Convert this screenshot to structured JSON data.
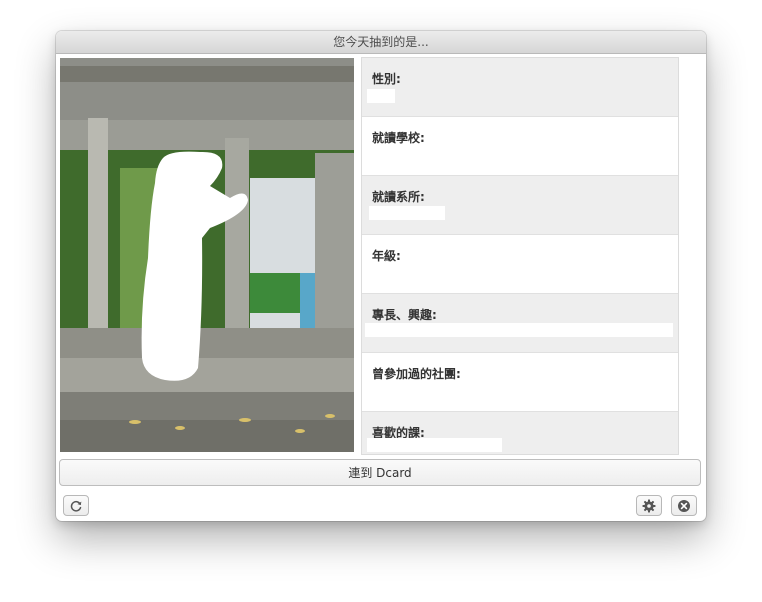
{
  "window": {
    "title": "您今天抽到的是..."
  },
  "profile": {
    "fields": [
      {
        "label": "性別:",
        "shaded": true
      },
      {
        "label": "就讀學校:",
        "shaded": false
      },
      {
        "label": "就讀系所:",
        "shaded": true
      },
      {
        "label": "年級:",
        "shaded": false
      },
      {
        "label": "專長、興趣:",
        "shaded": true
      },
      {
        "label": "曾參加過的社團:",
        "shaded": false
      },
      {
        "label": "喜歡的課:",
        "shaded": true
      }
    ]
  },
  "actions": {
    "dcard_label": "連到 Dcard",
    "refresh_icon": "refresh-icon",
    "settings_icon": "gear-icon",
    "close_icon": "close-circle-icon"
  },
  "colors": {
    "row_shade": "#eeeeee",
    "button_border": "#bdbdbd"
  }
}
